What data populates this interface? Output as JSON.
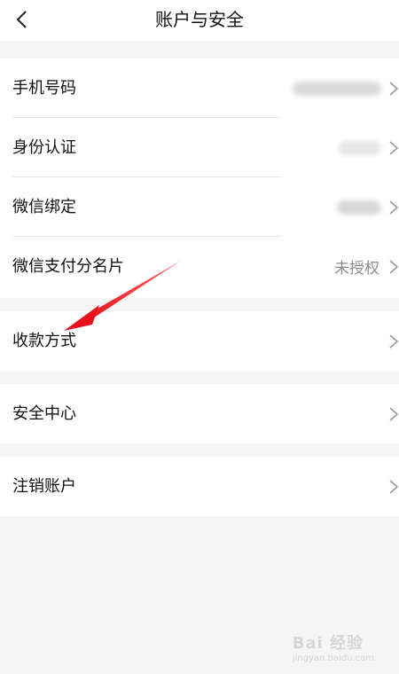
{
  "header": {
    "title": "账户与安全",
    "back_icon": "chevron-left-icon"
  },
  "groups": [
    {
      "rows": [
        {
          "label": "手机号码",
          "value": "",
          "value_hidden": true
        },
        {
          "label": "身份认证",
          "value": "",
          "value_hidden": true
        },
        {
          "label": "微信绑定",
          "value": "",
          "value_hidden": true
        },
        {
          "label": "微信支付分名片",
          "value": "未授权"
        }
      ]
    },
    {
      "rows": [
        {
          "label": "收款方式",
          "value": ""
        }
      ]
    },
    {
      "rows": [
        {
          "label": "安全中心",
          "value": ""
        }
      ]
    },
    {
      "rows": [
        {
          "label": "注销账户",
          "value": ""
        }
      ]
    }
  ],
  "annotation": {
    "arrow_color": "#e8101a"
  },
  "watermark": {
    "text": "Bai 经验",
    "sub": "jingyan.baidu.com"
  }
}
